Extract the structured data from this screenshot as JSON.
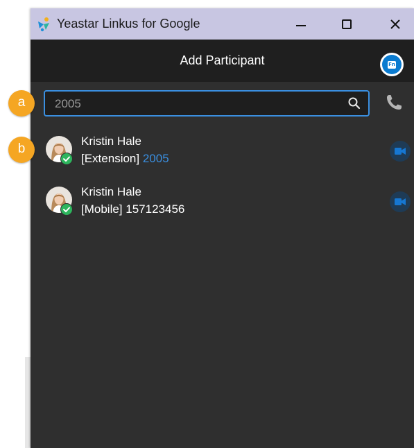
{
  "window": {
    "title": "Yeastar Linkus for Google",
    "controls": {
      "minimize_icon": "minimize-icon",
      "maximize_icon": "maximize-icon",
      "close_icon": "close-icon"
    }
  },
  "header": {
    "title": "Add Participant",
    "fn_badge": "Fn"
  },
  "search": {
    "value": "2005",
    "icon": "search-icon"
  },
  "contacts": [
    {
      "name": "Kristin Hale",
      "type_label": "[Extension]",
      "number": "2005",
      "presence": "available"
    },
    {
      "name": "Kristin Hale",
      "type_label": "[Mobile]",
      "number": "157123456",
      "presence": "available"
    }
  ],
  "callouts": {
    "a": "a",
    "b": "b"
  },
  "colors": {
    "titlebar": "#c8c6e2",
    "header": "#1f1f1f",
    "panel": "#2f2f2f",
    "accent": "#3a8fe0",
    "presence_green": "#2db55d",
    "callout": "#f5a623"
  }
}
